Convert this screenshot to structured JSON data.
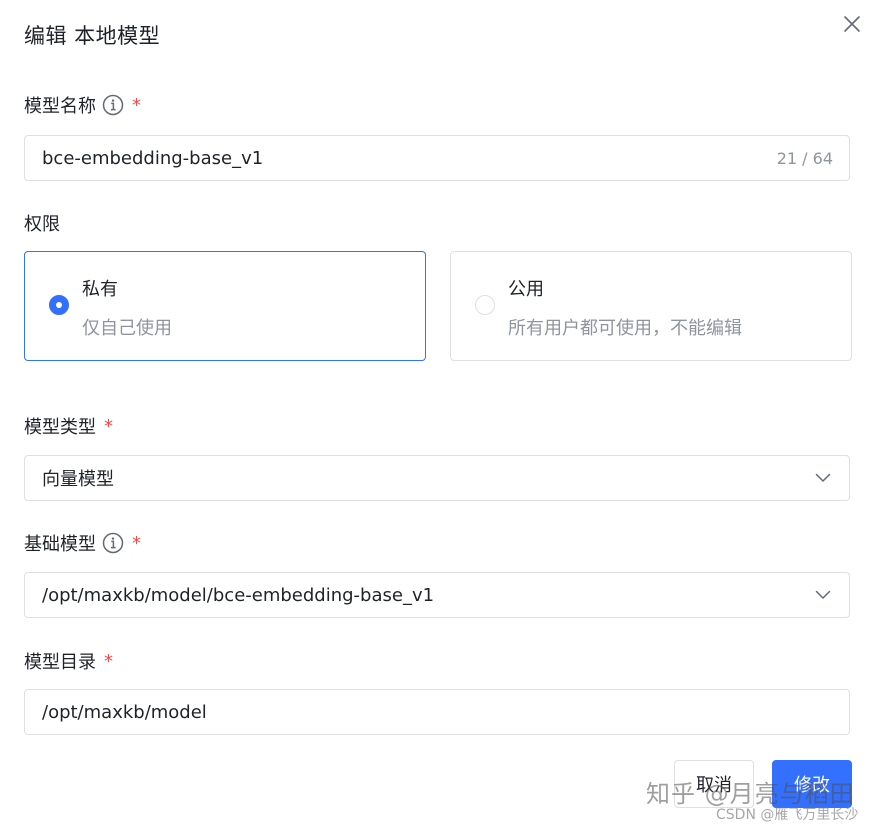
{
  "dialog": {
    "title": "编辑 本地模型"
  },
  "fields": {
    "model_name": {
      "label": "模型名称",
      "required_mark": "*",
      "value": "bce-embedding-base_v1",
      "counter": "21 / 64"
    },
    "permission": {
      "label": "权限",
      "options": [
        {
          "title": "私有",
          "desc": "仅自己使用",
          "selected": true
        },
        {
          "title": "公用",
          "desc": "所有用户都可使用，不能编辑",
          "selected": false
        }
      ]
    },
    "model_type": {
      "label": "模型类型",
      "required_mark": "*",
      "value": "向量模型"
    },
    "base_model": {
      "label": "基础模型",
      "required_mark": "*",
      "value": "/opt/maxkb/model/bce-embedding-base_v1"
    },
    "model_dir": {
      "label": "模型目录",
      "required_mark": "*",
      "value": "/opt/maxkb/model"
    }
  },
  "footer": {
    "cancel_label": "取消",
    "confirm_label": "修改"
  },
  "watermark": {
    "main": "知乎 @月亮与稻田",
    "sub": "CSDN @雁飞万里长沙"
  },
  "colors": {
    "primary": "#3370ff",
    "required": "#f54a45",
    "border": "#dee0e3",
    "muted_text": "#8f959e"
  },
  "icons": {
    "close": "close-icon",
    "info": "info-icon",
    "dropdown": "chevron-down-icon"
  }
}
